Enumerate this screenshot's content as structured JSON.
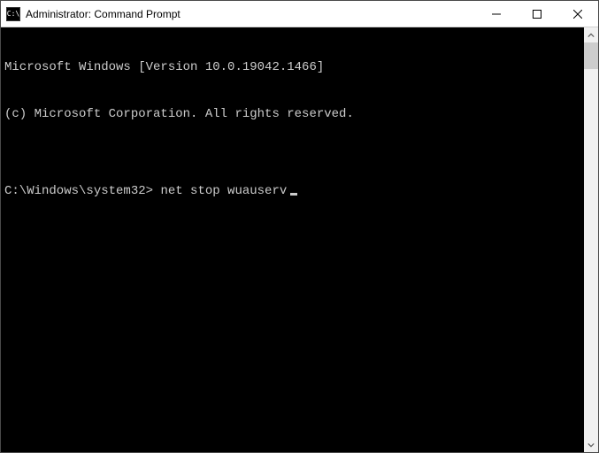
{
  "titlebar": {
    "icon_text": "C:\\",
    "title": "Administrator: Command Prompt"
  },
  "terminal": {
    "line1": "Microsoft Windows [Version 10.0.19042.1466]",
    "line2": "(c) Microsoft Corporation. All rights reserved.",
    "blank": "",
    "prompt": "C:\\Windows\\system32>",
    "command": "net stop wuauserv"
  }
}
